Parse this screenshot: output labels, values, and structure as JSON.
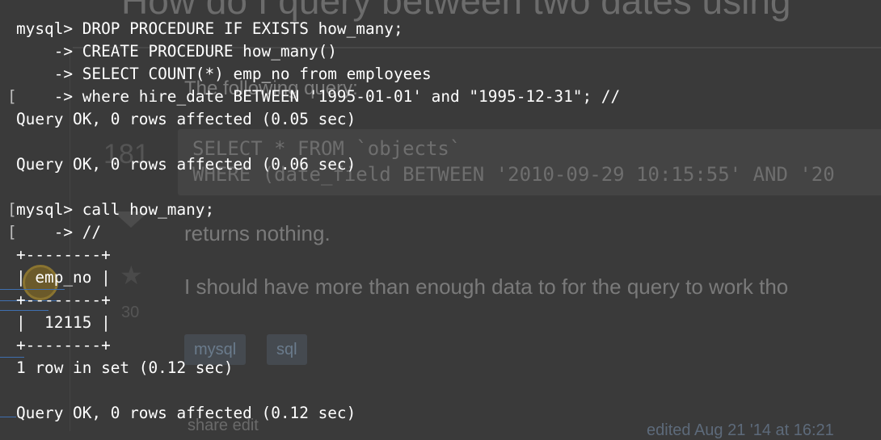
{
  "background_page": {
    "title": "How do I query between two dates using",
    "intro": "The following query:",
    "code_line1": "SELECT * FROM `objects`",
    "code_line2": "WHERE (date_field BETWEEN '2010-09-29 10:15:55' AND '20",
    "vote_count": "181",
    "favorite_count": "30",
    "returns_text": "returns nothing.",
    "paragraph": "I should have more than enough data to for the query to work tho",
    "tags": [
      "mysql",
      "sql"
    ],
    "share": "share  edit",
    "edited": "edited Aug 21 '14 at 16:21"
  },
  "terminal": {
    "lines": [
      "mysql> DROP PROCEDURE IF EXISTS how_many;",
      "    -> CREATE PROCEDURE how_many()",
      "    -> SELECT COUNT(*) emp_no from employees",
      "    -> where hire_date BETWEEN '1995-01-01' and \"1995-12-31\"; //",
      "Query OK, 0 rows affected (0.05 sec)",
      "",
      "Query OK, 0 rows affected (0.06 sec)",
      "",
      "mysql> call how_many;",
      "    -> //",
      "+--------+",
      "| emp_no |",
      "+--------+",
      "|  12115 |",
      "+--------+",
      "1 row in set (0.12 sec)",
      "",
      "Query OK, 0 rows affected (0.12 sec)"
    ],
    "bracket_char": "["
  },
  "colors": {
    "terminal_text": "#ffffff",
    "background": "#3a3a3a",
    "link_blue": "#3f6fb0"
  }
}
